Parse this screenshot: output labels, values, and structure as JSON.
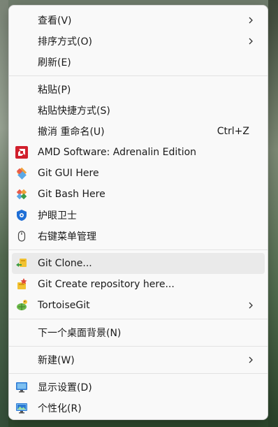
{
  "groups": [
    {
      "items": [
        {
          "label": "查看(V)",
          "submenu": true
        },
        {
          "label": "排序方式(O)",
          "submenu": true
        },
        {
          "label": "刷新(E)"
        }
      ]
    },
    {
      "items": [
        {
          "label": "粘贴(P)"
        },
        {
          "label": "粘贴快捷方式(S)"
        },
        {
          "label": "撤消 重命名(U)",
          "shortcut": "Ctrl+Z"
        },
        {
          "label": "AMD Software: Adrenalin Edition",
          "icon": "amd-icon"
        },
        {
          "label": "Git GUI Here",
          "icon": "git-gui-icon"
        },
        {
          "label": "Git Bash Here",
          "icon": "git-bash-icon"
        },
        {
          "label": "护眼卫士",
          "icon": "eye-guard-icon"
        },
        {
          "label": "右键菜单管理",
          "icon": "mouse-icon"
        }
      ]
    },
    {
      "items": [
        {
          "label": "Git Clone...",
          "icon": "git-clone-icon",
          "hover": true
        },
        {
          "label": "Git Create repository here...",
          "icon": "git-create-repo-icon"
        },
        {
          "label": "TortoiseGit",
          "icon": "tortoisegit-icon",
          "submenu": true
        }
      ]
    },
    {
      "items": [
        {
          "label": "下一个桌面背景(N)"
        }
      ]
    },
    {
      "items": [
        {
          "label": "新建(W)",
          "submenu": true
        }
      ]
    },
    {
      "items": [
        {
          "label": "显示设置(D)",
          "icon": "display-settings-icon"
        },
        {
          "label": "个性化(R)",
          "icon": "personalize-icon"
        }
      ]
    }
  ]
}
